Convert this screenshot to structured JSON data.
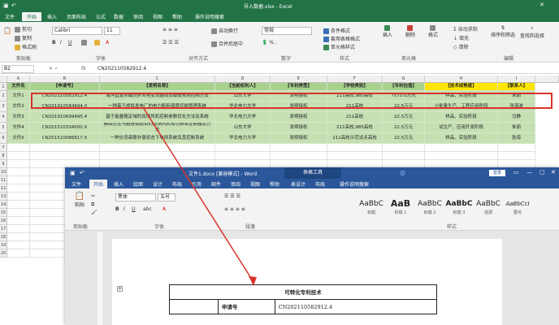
{
  "excel": {
    "title": "导入数据.xlsx - Excel",
    "tabs": [
      "文件",
      "开始",
      "插入",
      "页面布局",
      "公式",
      "数据",
      "审阅",
      "视图",
      "帮助",
      "操作说明搜索"
    ],
    "ribbon": {
      "cut": "剪切",
      "copy": "复制",
      "format_painter": "格式刷",
      "clipboard": "剪贴板",
      "font_name": "Calibri",
      "font_size": "11",
      "font_group": "字体",
      "wrap": "自动换行",
      "merge": "合并后居中",
      "align_group": "对齐方式",
      "number_format": "常规",
      "number_group": "数字",
      "cond_format": "条件格式",
      "table_format": "套用表格格式",
      "cell_style": "单元格样式",
      "style_group": "样式",
      "insert": "插入",
      "delete": "删除",
      "format": "格式",
      "cells_group": "单元格",
      "autosum": "自动求和",
      "fill": "填充",
      "clear": "清除",
      "sort": "排序和筛选",
      "find": "查找和选择",
      "edit_group": "编辑"
    },
    "namebox": "B2",
    "fx": "fx",
    "formula": "CN202110582912.4",
    "columns": [
      "A",
      "B",
      "C",
      "D",
      "E",
      "F",
      "G",
      "H",
      "I"
    ],
    "rows": [
      "1",
      "2",
      "3",
      "4",
      "5",
      "6",
      "7",
      "8",
      "9",
      "10",
      "11",
      "12",
      "13",
      "14",
      "15",
      "16",
      "17",
      "18",
      "19",
      "20"
    ],
    "headers": [
      "文件名",
      "【申请号】",
      "【发明名称】",
      "【当前权利人】",
      "【专利类型】",
      "【学校类别】",
      "【专利估值】",
      "【技术成熟度】",
      "【联系人】"
    ],
    "data": [
      [
        "文件1",
        "CN202110582912.4",
        "海洋直驱永磁同步风电变流器动态级联预测控制方法",
        "山东大学",
        "发明授权",
        "211高校,985高校",
        "7575.0万元",
        "样品、实验阶段",
        "朱丽"
      ],
      [
        "文件2",
        "CN201910584694.0",
        "一种基于虚拟发电厂的电力配网调度控制管理系统",
        "华北电力大学",
        "发明授权",
        "211高校",
        "22.5万元",
        "小批量生产、工程应用阶段",
        "张海波"
      ],
      [
        "文件3",
        "CN201910699495.4",
        "基于能量稳定域的双馈风机控制参数优化方法及系统",
        "华北电力大学",
        "发明授权",
        "211高校",
        "22.5万元",
        "样品、实验阶段",
        "马静"
      ],
      [
        "文件4",
        "CN201510334000.X",
        "模拟惯性与超速相结合的双馈风机有功频率控制器及方法",
        "山东大学",
        "发明授权",
        "211高校,985高校",
        "22.5万元",
        "试生产、应用开发阶段",
        "朱丽"
      ],
      [
        "文件5",
        "CN201510086817.X",
        "一种交流串联补偿状态下电网系统及其控制系统",
        "华北电力大学",
        "发明授权",
        "211高校示范试点高校",
        "22.5万元",
        "样品、实验阶段",
        "张海"
      ]
    ]
  },
  "word": {
    "title": "文件1.docx [兼容模式] - Word",
    "tool_tab": "表格工具",
    "login": "登录",
    "tabs": [
      "文件",
      "开始",
      "插入",
      "绘图",
      "设计",
      "布局",
      "引用",
      "邮件",
      "审阅",
      "视图",
      "帮助",
      "表设计",
      "布局",
      "操作说明搜索"
    ],
    "ribbon": {
      "paste": "粘贴",
      "clipboard": "剪贴板",
      "font_name": "黑体",
      "font_size": "五号",
      "font_group": "字体",
      "para_group": "段落",
      "style_group": "样式",
      "styles": [
        {
          "preview": "AaBbC",
          "label": "标题"
        },
        {
          "preview": "AaB",
          "label": "标题 1"
        },
        {
          "preview": "AaBbC",
          "label": "标题 2"
        },
        {
          "preview": "AaBbC",
          "label": "标题 3"
        },
        {
          "preview": "AaBbC",
          "label": "强调"
        },
        {
          "preview": "AaBbCcI",
          "label": "要点"
        }
      ]
    },
    "doc_title": "可转化专利技术",
    "table": [
      [
        "申请号",
        "CN202110582912.4"
      ]
    ]
  }
}
